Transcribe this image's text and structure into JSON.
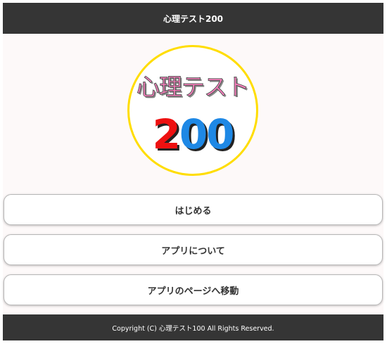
{
  "header": {
    "title": "心理テスト200"
  },
  "logo": {
    "text": "心理テスト",
    "number_first": "2",
    "number_rest": "00",
    "ring_color": "#ffdd00"
  },
  "menu": {
    "start_label": "はじめる",
    "about_label": "アプリについて",
    "page_label": "アプリのページへ移動"
  },
  "footer": {
    "copyright": "Copyright (C) 心理テスト100 All Rights Reserved."
  },
  "colors": {
    "bar": "#353535",
    "background": "#fdf9f9"
  }
}
